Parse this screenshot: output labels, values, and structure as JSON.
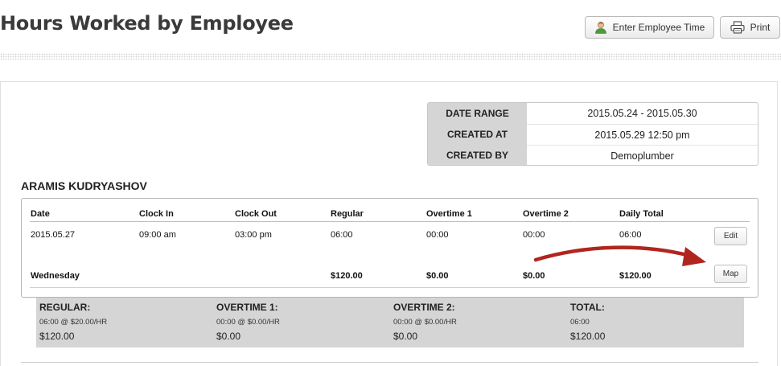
{
  "page": {
    "title": "Hours Worked by Employee",
    "enter_time_label": "Enter Employee Time",
    "print_label": "Print"
  },
  "report_meta": [
    {
      "label": "DATE RANGE",
      "value": "2015.05.24 - 2015.05.30"
    },
    {
      "label": "CREATED AT",
      "value": "2015.05.29 12:50 pm"
    },
    {
      "label": "CREATED BY",
      "value": "Demoplumber"
    }
  ],
  "employee": {
    "name": "ARAMIS KUDRYASHOV",
    "columns": [
      "Date",
      "Clock In",
      "Clock Out",
      "Regular",
      "Overtime 1",
      "Overtime 2",
      "Daily Total"
    ],
    "entry": {
      "date": "2015.05.27",
      "clock_in": "09:00 am",
      "clock_out": "03:00 pm",
      "regular": "06:00",
      "overtime1": "00:00",
      "overtime2": "00:00",
      "daily_total": "06:00"
    },
    "day_summary": {
      "weekday": "Wednesday",
      "regular": "$120.00",
      "overtime1": "$0.00",
      "overtime2": "$0.00",
      "daily_total": "$120.00"
    },
    "edit_label": "Edit",
    "map_label": "Map"
  },
  "totals": [
    {
      "heading": "REGULAR:",
      "detail": "06:00 @ $20.00/HR",
      "amount": "$120.00"
    },
    {
      "heading": "OVERTIME 1:",
      "detail": "00:00 @ $0.00/HR",
      "amount": "$0.00"
    },
    {
      "heading": "OVERTIME 2:",
      "detail": "00:00 @ $0.00/HR",
      "amount": "$0.00"
    },
    {
      "heading": "TOTAL:",
      "detail": "06:00",
      "amount": "$120.00"
    }
  ],
  "colors": {
    "annotation_arrow": "#b0261f",
    "summary_background": "#d5d5d5"
  },
  "icons": {
    "enter_time": "person-icon",
    "print": "printer-icon"
  }
}
